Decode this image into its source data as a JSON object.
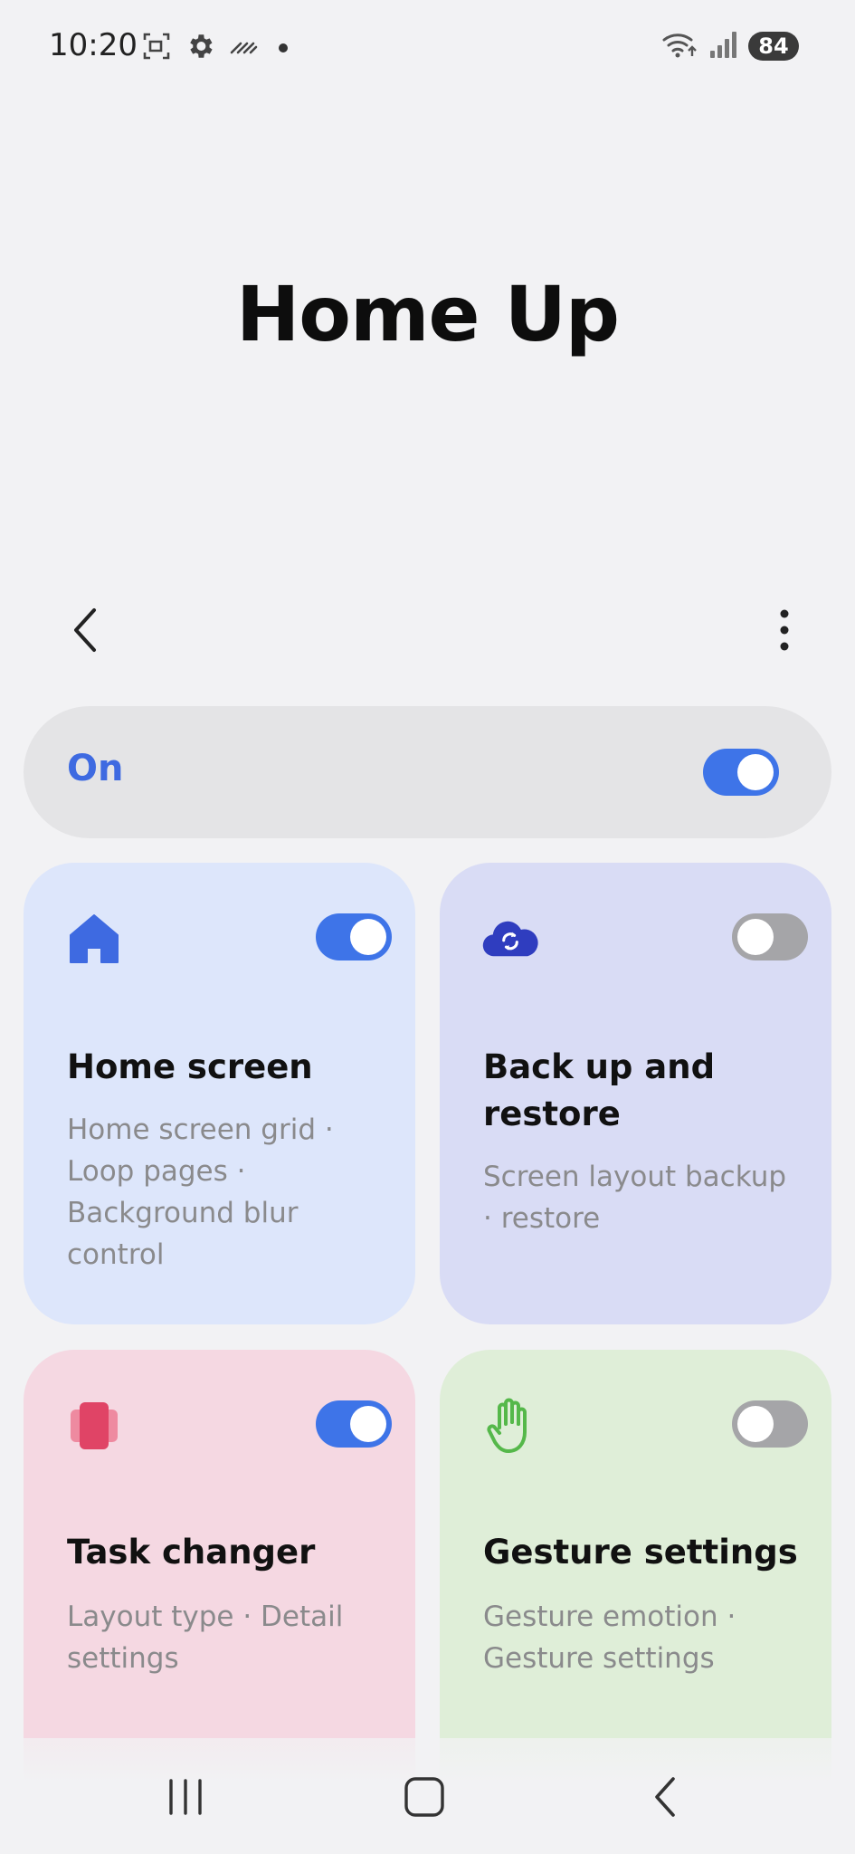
{
  "status_bar": {
    "time": "10:20",
    "battery": "84",
    "left_icons": [
      "screenshot-icon",
      "settings-gear-icon",
      "hatch-icon",
      "dot-icon"
    ],
    "right_icons": [
      "wifi-icon",
      "signal-icon",
      "battery-icon"
    ]
  },
  "page": {
    "title": "Home Up"
  },
  "toolbar": {
    "back_icon": "chevron-left-icon",
    "more_icon": "more-vertical-icon"
  },
  "master_switch": {
    "label": "On",
    "enabled": true
  },
  "cards": [
    {
      "title": "Home screen",
      "description": "Home screen grid · Loop pages · Background blur control",
      "icon": "home-icon",
      "enabled": true
    },
    {
      "title": "Back up and restore",
      "description": "Screen layout backup · restore",
      "icon": "cloud-sync-icon",
      "enabled": false
    },
    {
      "title": "Task changer",
      "description": "Layout type · Detail settings",
      "icon": "task-cards-icon",
      "enabled": true
    },
    {
      "title": "Gesture settings",
      "description": "Gesture emotion · Gesture settings",
      "icon": "hand-icon",
      "enabled": false
    }
  ],
  "colors": {
    "accent": "#3e74e8",
    "background": "#f2f2f4",
    "home_card": "#dde6fb",
    "backup_card": "#d9dcf5",
    "task_card": "#f5d8e2",
    "gesture_card": "#dfeed8"
  },
  "nav_bar": {
    "icons": [
      "recents-icon",
      "home-nav-icon",
      "back-nav-icon"
    ]
  }
}
